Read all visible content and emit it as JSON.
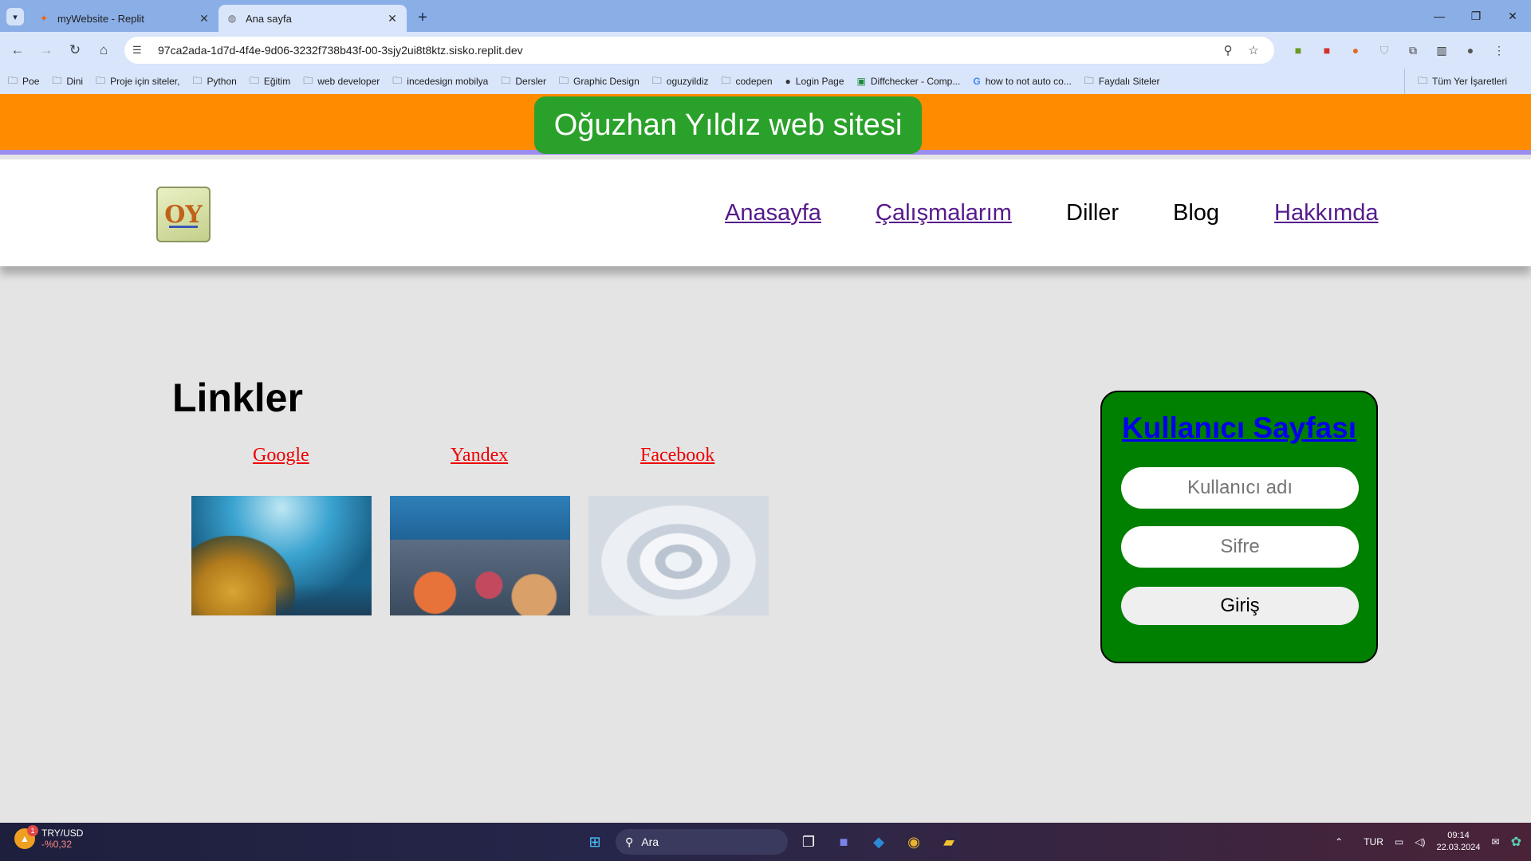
{
  "browser": {
    "tabs": [
      {
        "title": "myWebsite - Replit",
        "active": false,
        "icon": "replit-icon"
      },
      {
        "title": "Ana sayfa",
        "active": true,
        "icon": "globe-icon"
      }
    ],
    "url": "97ca2ada-1d7d-4f4e-9d06-3232f738b43f-00-3sjy2ui8t8ktz.sisko.replit.dev",
    "bookmarks": [
      "Poe",
      "Dini",
      "Proje için siteler,",
      "Python",
      "Eğitim",
      "web developer",
      "incedesign mobilya",
      "Dersler",
      "Graphic Design",
      "oguzyildiz",
      "codepen",
      "Login Page",
      "Diffchecker - Comp...",
      "how to not auto co...",
      "Faydalı Siteler"
    ],
    "all_bookmarks": "Tüm Yer İşaretleri"
  },
  "page": {
    "banner_title": "Oğuzhan Yıldız web sitesi",
    "logo_text": "OY",
    "nav": {
      "home": "Anasayfa",
      "works": "Çalışmalarım",
      "languages": "Diller",
      "blog": "Blog",
      "about": "Hakkımda"
    },
    "links_heading": "Linkler",
    "links": [
      "Google",
      "Yandex",
      "Facebook"
    ],
    "user_card": {
      "title": "Kullanıcı Sayfası",
      "username_placeholder": "Kullanıcı adı",
      "password_placeholder": "Sifre",
      "login_label": "Giriş"
    },
    "colors": {
      "banner": "#ff8c00",
      "banner_title_bg": "#2aa12a",
      "card_bg": "#008000",
      "visited_link": "#551a8b",
      "red_link": "#ee0000"
    }
  },
  "taskbar": {
    "ticker_name": "TRY/USD",
    "ticker_change": "-%0,32",
    "ticker_badge": "1",
    "search_label": "Ara",
    "lang": "TUR",
    "time": "09:14",
    "date": "22.03.2024"
  }
}
